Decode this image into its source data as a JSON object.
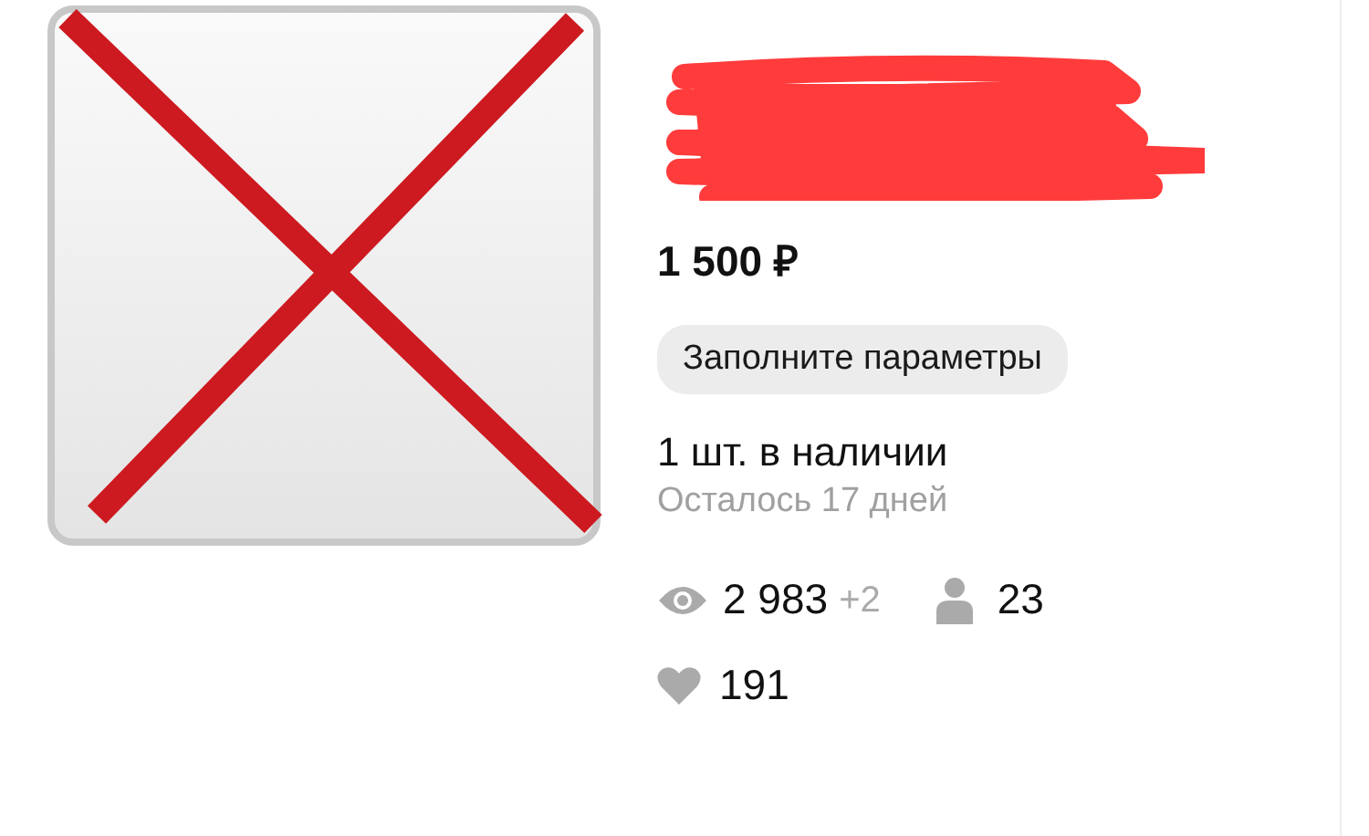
{
  "listing": {
    "image": {
      "kind": "placeholder"
    },
    "price": "1 500 ₽",
    "params_chip": "Заполните параметры",
    "stock": "1 шт. в наличии",
    "days_left": "Осталось 17 дней",
    "stats": {
      "views": "2 983",
      "views_delta": "+2",
      "subscribers": "23",
      "likes": "191"
    }
  }
}
